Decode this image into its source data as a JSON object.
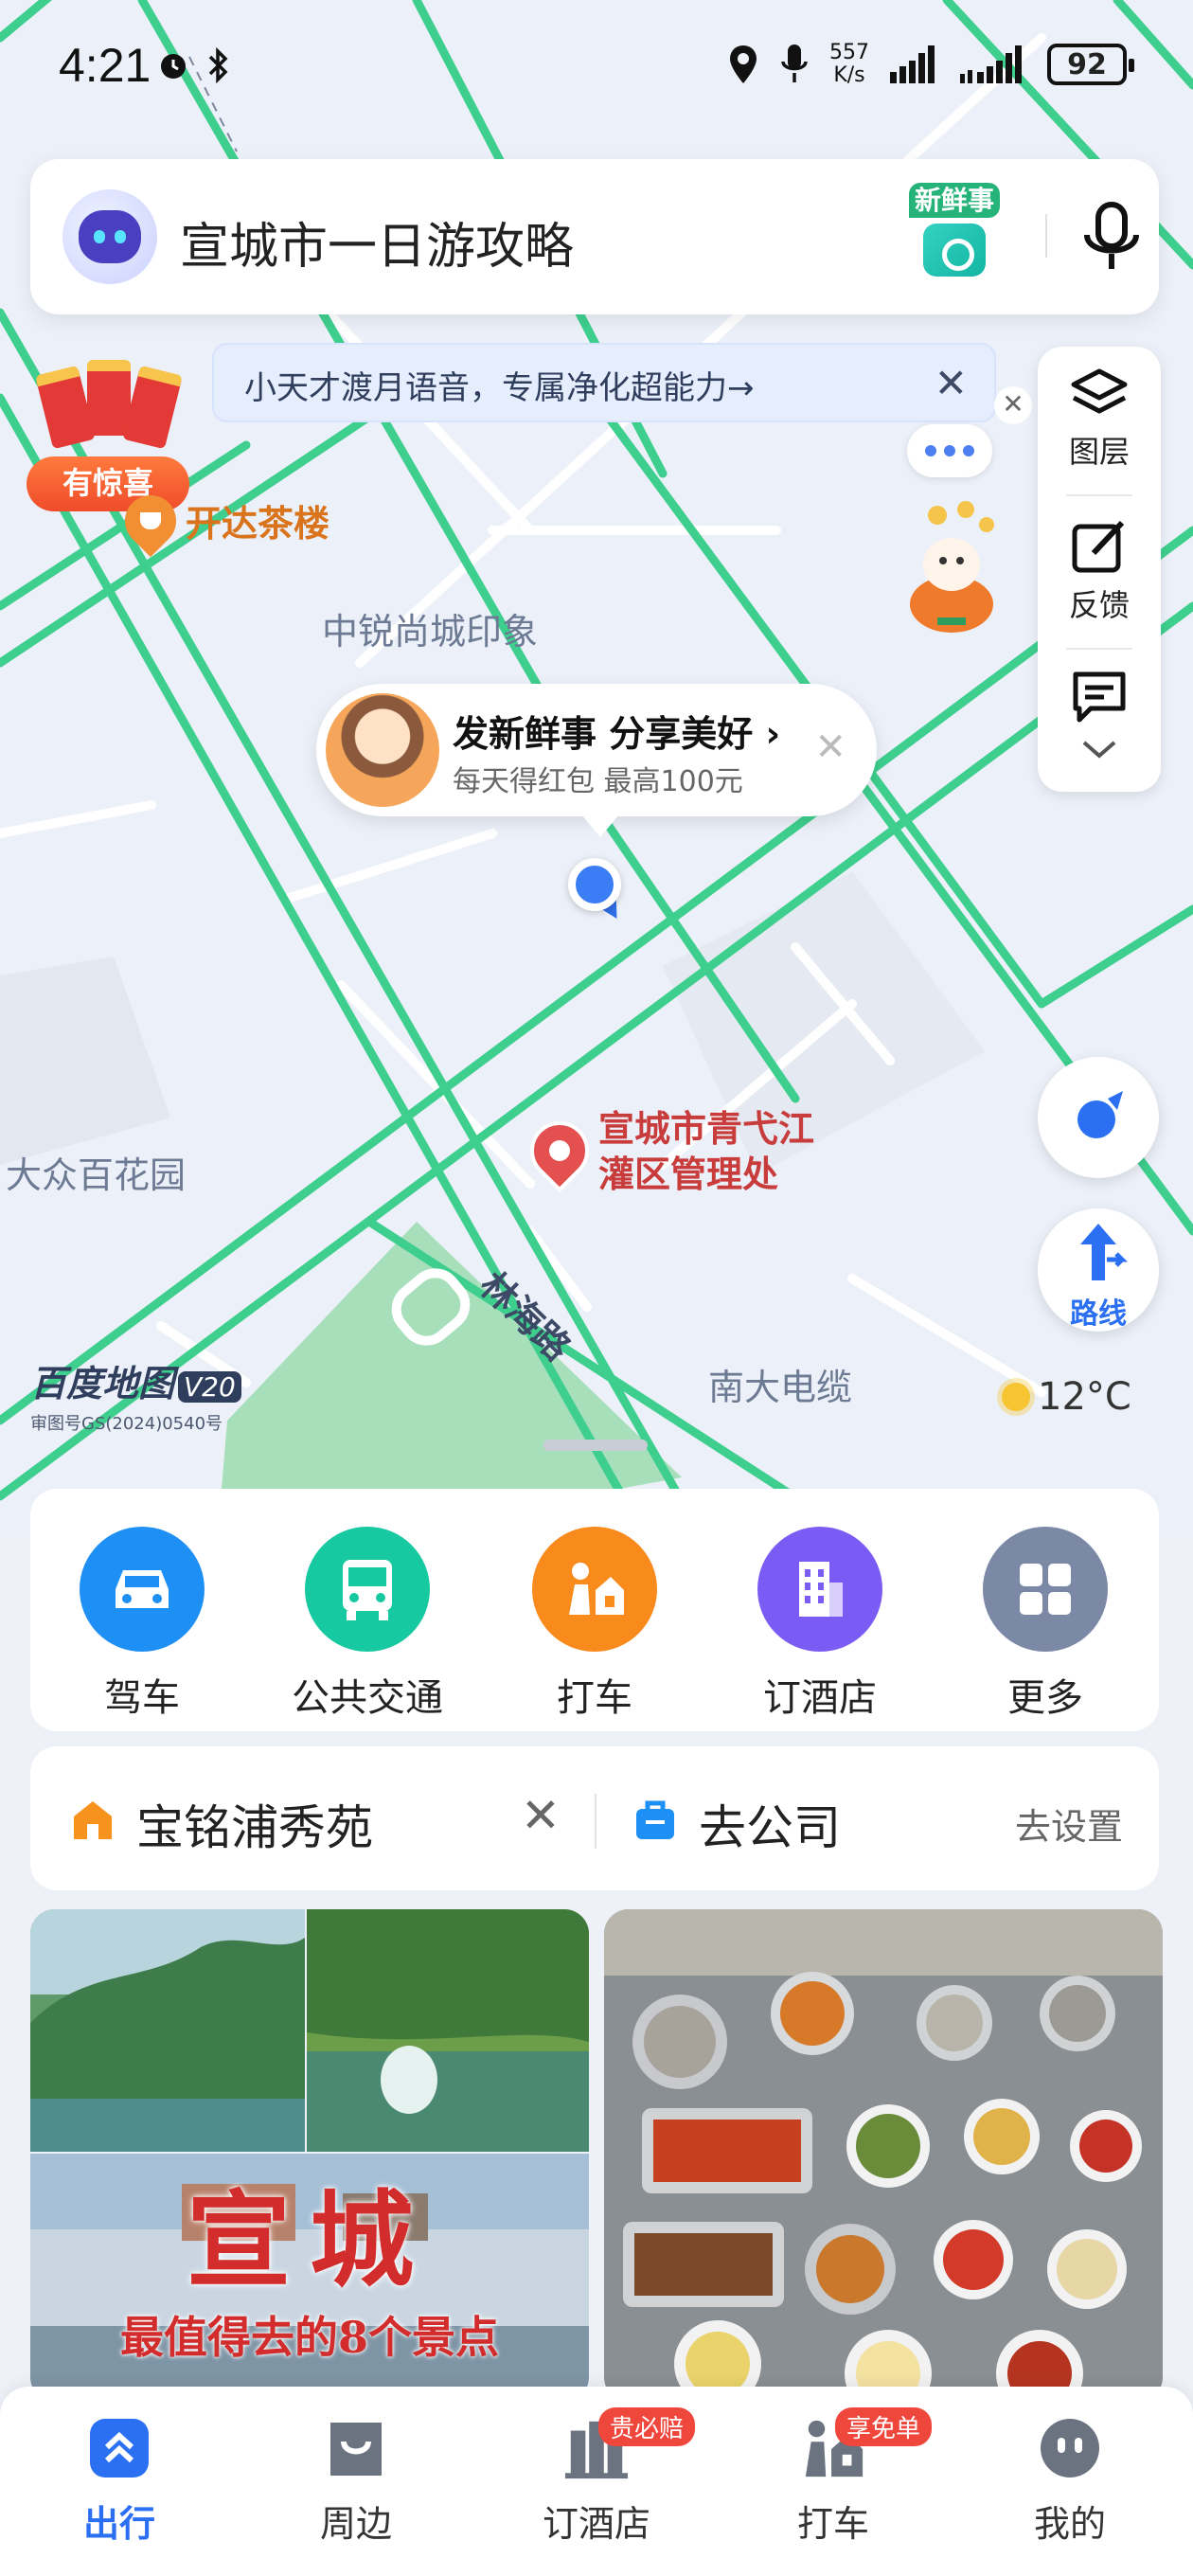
{
  "status_bar": {
    "time": "4:21",
    "speed_value": "557",
    "speed_unit": "K/s",
    "battery": "92"
  },
  "search": {
    "placeholder": "宣城市一日游攻略",
    "fresh_badge": "新鲜事"
  },
  "notice": {
    "text": "小天才渡月语音，专属净化超能力→",
    "close": "✕"
  },
  "promo": {
    "label": "有惊喜"
  },
  "map": {
    "labels": {
      "teahouse": "开达茶楼",
      "zhongrui": "中锐尚城印象",
      "dazhong": "大众百花园",
      "admin_line1": "宣城市青弋江",
      "admin_line2": "灌区管理处",
      "road": "林海路",
      "nanda": "南大电缆"
    },
    "share_bubble": {
      "title": "发新鲜事 分享美好 ›",
      "subtitle": "每天得红包 最高100元",
      "close": "✕"
    },
    "logo": {
      "name": "百度地图",
      "version": "V20",
      "approval": "审图号GS(2024)0540号"
    },
    "weather": {
      "temp": "12°C"
    }
  },
  "tools": {
    "layers": "图层",
    "feedback": "反馈",
    "route": "路线",
    "close": "✕"
  },
  "quick_actions": [
    {
      "label": "驾车",
      "color": "#1d8ff5"
    },
    {
      "label": "公共交通",
      "color": "#16c9a0"
    },
    {
      "label": "打车",
      "color": "#f98a1c"
    },
    {
      "label": "订酒店",
      "color": "#7a5cf5"
    },
    {
      "label": "更多",
      "color": "#7b88a6"
    }
  ],
  "shortcuts": {
    "home_name": "宝铭浦秀苑",
    "home_close": "✕",
    "work_name": "去公司",
    "work_action": "去设置"
  },
  "feed": {
    "left_title": "宣城",
    "left_subtitle": "最值得去的8个景点"
  },
  "tabbar": [
    {
      "label": "出行",
      "active": true
    },
    {
      "label": "周边"
    },
    {
      "label": "订酒店",
      "badge": "贵必赔"
    },
    {
      "label": "打车",
      "badge": "享免单"
    },
    {
      "label": "我的"
    }
  ],
  "colors": {
    "accent": "#2b6ff2",
    "road": "#3ecf8e"
  }
}
